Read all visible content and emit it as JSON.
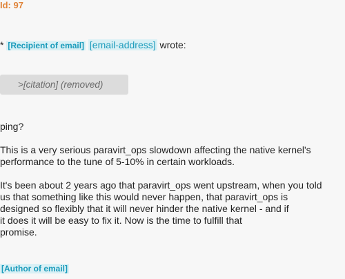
{
  "email": {
    "id_line": "Id: 97",
    "quote_prefix": "*",
    "recipient_tag": "[Recipient of email]",
    "address_tag": "[email-address]",
    "wrote": "wrote:",
    "citation": ">[citation] (removed)",
    "paragraphs": {
      "p1": "ping?",
      "p2_line1": "This is a very serious paravirt_ops slowdown affecting the native kernel's",
      "p2_line2": "performance to the tune of 5-10% in certain workloads.",
      "p3_line1": "It's been about 2 years ago that paravirt_ops went upstream, when you told",
      "p3_line2": "us that something like this would never happen, that paravirt_ops is",
      "p3_line3": "designed so flexibly that it will never hinder the native kernel - and if",
      "p3_line4": "it does it will be easy to fix it. Now is the time to fulfill that",
      "p3_line5": "promise."
    },
    "author_tag": "[Author of email]"
  },
  "colors": {
    "id_color": "#e0843a",
    "tag_text": "#1a9bbb",
    "tag_bg": "#d9f0f5",
    "citation_bg": "#dcdcdc",
    "page_bg": "#f7f7f7"
  }
}
